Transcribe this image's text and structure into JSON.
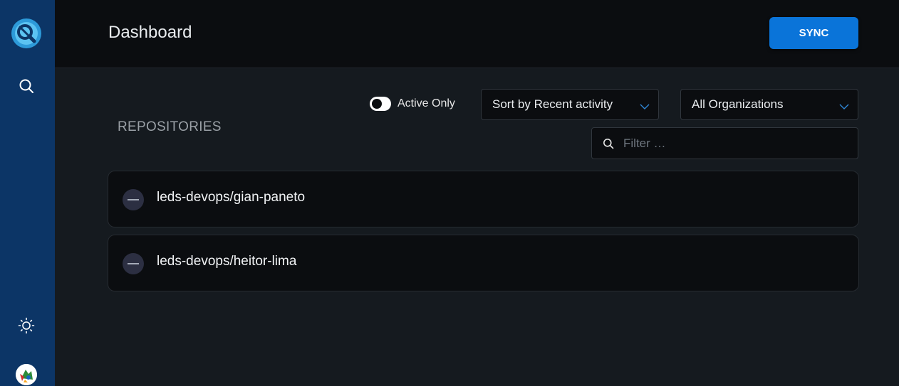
{
  "header": {
    "title": "Dashboard",
    "sync_label": "SYNC"
  },
  "sidebar": {
    "items": [
      {
        "icon": "logo-icon"
      },
      {
        "icon": "search-icon"
      },
      {
        "icon": "sun-icon"
      },
      {
        "icon": "avatar"
      }
    ]
  },
  "filters": {
    "active_only_label": "Active Only",
    "active_only_checked": false,
    "sort_selected": "Sort by Recent activity",
    "org_selected": "All Organizations",
    "filter_placeholder": "Filter …"
  },
  "section": {
    "title": "REPOSITORIES"
  },
  "repositories": [
    {
      "name": "leds-devops/gian-paneto",
      "status": "inactive"
    },
    {
      "name": "leds-devops/heitor-lima",
      "status": "inactive"
    }
  ],
  "colors": {
    "sidebar": "#0c3566",
    "accent": "#0a74d9",
    "background": "#151a1f",
    "card": "#0b0d10"
  }
}
